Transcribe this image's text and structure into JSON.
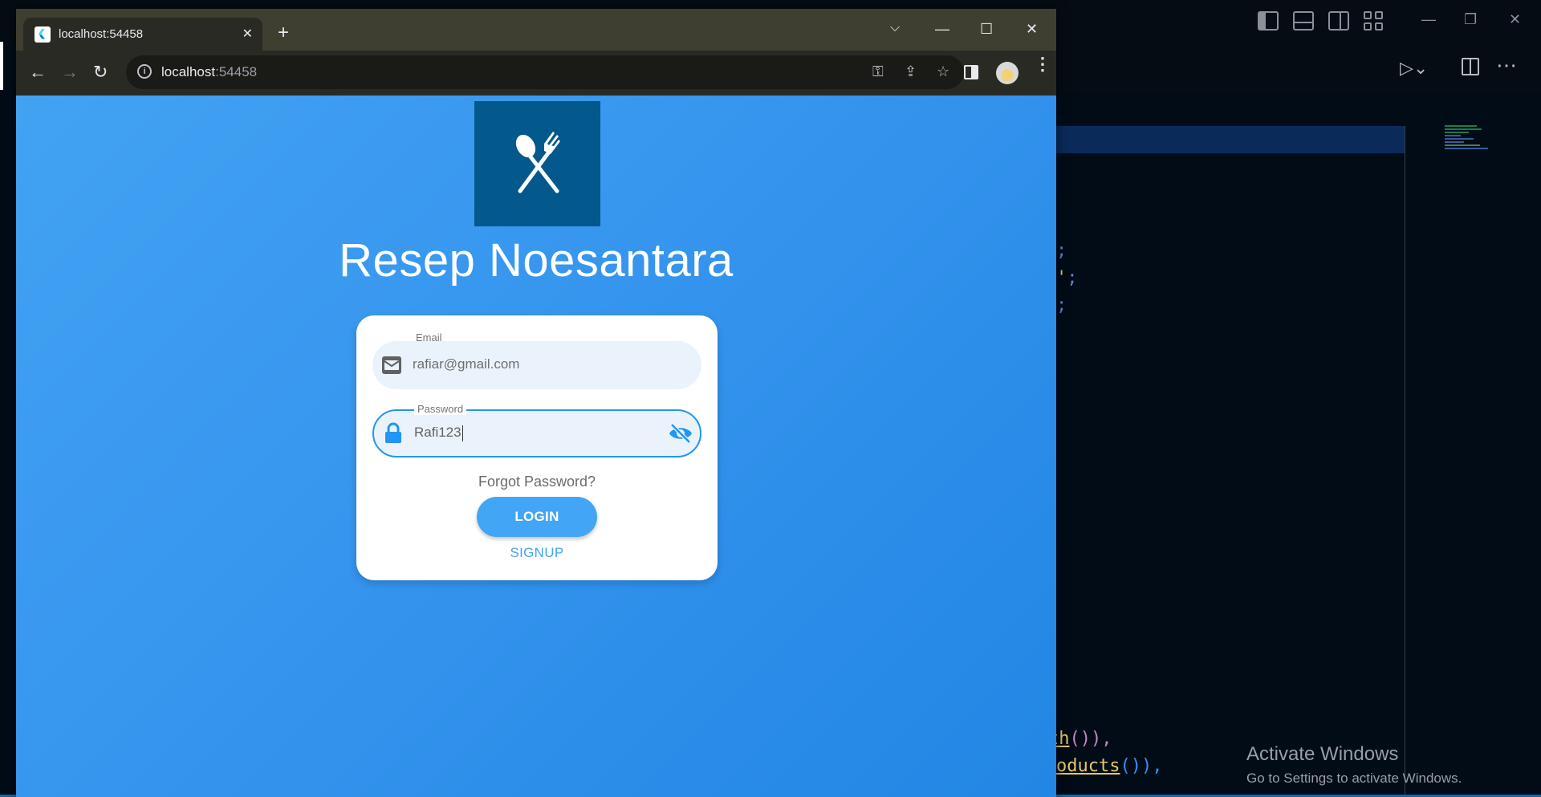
{
  "browser": {
    "tab_title": "localhost:54458",
    "url_host": "localhost",
    "url_port": ":54458"
  },
  "app": {
    "title": "Resep Noesantara"
  },
  "login_form": {
    "email_label": "Email",
    "email_value": "rafiar@gmail.com",
    "password_label": "Password",
    "password_value": "Rafi123",
    "forgot_text": "Forgot Password?",
    "login_label": "LOGIN",
    "signup_label": "SIGNUP"
  },
  "editor": {
    "code": {
      "l1": ";",
      "l2_tok": "'",
      "l2_end": ";",
      "l3": ";",
      "l4_tok": "th",
      "l4_end": "()),",
      "l5_tok": "oducts",
      "l5_end": "()),"
    },
    "watermark": {
      "title": "Activate Windows",
      "subtitle": "Go to Settings to activate Windows."
    }
  },
  "colors": {
    "page_gradient_start": "#42a2f2",
    "page_gradient_end": "#2286e4",
    "logo_bg": "#03588c",
    "primary": "#42a5f5",
    "field_bg": "#eaf3fc"
  }
}
